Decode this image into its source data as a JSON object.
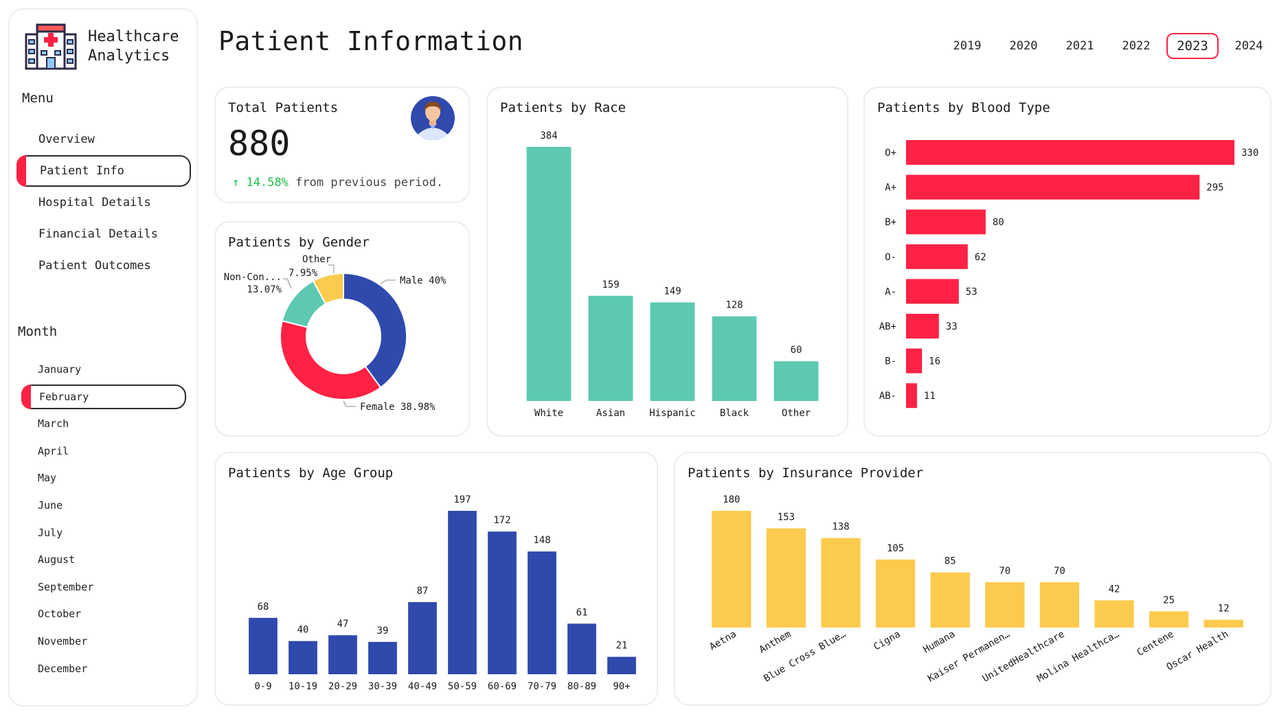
{
  "brand": {
    "title": "Healthcare\nAnalytics"
  },
  "menu": {
    "title": "Menu",
    "items": [
      {
        "label": "Overview",
        "active": false
      },
      {
        "label": "Patient Info",
        "active": true
      },
      {
        "label": "Hospital Details",
        "active": false
      },
      {
        "label": "Financial Details",
        "active": false
      },
      {
        "label": "Patient Outcomes",
        "active": false
      }
    ]
  },
  "month": {
    "title": "Month",
    "items": [
      {
        "label": "January",
        "active": false
      },
      {
        "label": "February",
        "active": true
      },
      {
        "label": "March",
        "active": false
      },
      {
        "label": "April",
        "active": false
      },
      {
        "label": "May",
        "active": false
      },
      {
        "label": "June",
        "active": false
      },
      {
        "label": "July",
        "active": false
      },
      {
        "label": "August",
        "active": false
      },
      {
        "label": "September",
        "active": false
      },
      {
        "label": "October",
        "active": false
      },
      {
        "label": "November",
        "active": false
      },
      {
        "label": "December",
        "active": false
      }
    ]
  },
  "header": {
    "title": "Patient Information",
    "years": [
      "2019",
      "2020",
      "2021",
      "2022",
      "2023",
      "2024"
    ],
    "selected_year": "2023"
  },
  "total": {
    "title": "Total Patients",
    "value": "880",
    "change": "14.58%",
    "change_arrow": "↑",
    "change_suffix": "from previous period."
  },
  "colors": {
    "accent": "#ff2244",
    "teal": "#5cc9b0",
    "red": "#ff2244",
    "blue": "#2f49ad",
    "yellow": "#fccb4e",
    "green": "#1cbf4a"
  },
  "chart_data": [
    {
      "id": "race",
      "type": "bar",
      "title": "Patients by Race",
      "categories": [
        "White",
        "Asian",
        "Hispanic",
        "Black",
        "Other"
      ],
      "values": [
        384,
        159,
        149,
        128,
        60
      ],
      "color": "#5cc9b0"
    },
    {
      "id": "blood",
      "type": "bar",
      "orientation": "horizontal",
      "title": "Patients by Blood Type",
      "categories": [
        "O+",
        "A+",
        "B+",
        "O-",
        "A-",
        "AB+",
        "B-",
        "AB-"
      ],
      "values": [
        330,
        295,
        80,
        62,
        53,
        33,
        16,
        11
      ],
      "color": "#ff2244"
    },
    {
      "id": "gender",
      "type": "pie",
      "donut": true,
      "title": "Patients by Gender",
      "slices": [
        {
          "name": "Male",
          "pct": 40,
          "label": "Male 40%",
          "color": "#2f49ad"
        },
        {
          "name": "Female",
          "pct": 38.98,
          "label": "Female 38.98%",
          "color": "#ff2244"
        },
        {
          "name": "Non-Con...",
          "pct": 13.07,
          "label": "Non-Con...",
          "label2": "13.07%",
          "color": "#5cc9b0"
        },
        {
          "name": "Other",
          "pct": 7.95,
          "label": "Other",
          "label2": "7.95%",
          "color": "#fccb4e"
        }
      ]
    },
    {
      "id": "age",
      "type": "bar",
      "title": "Patients by Age Group",
      "categories": [
        "0-9",
        "10-19",
        "20-29",
        "30-39",
        "40-49",
        "50-59",
        "60-69",
        "70-79",
        "80-89",
        "90+"
      ],
      "values": [
        68,
        40,
        47,
        39,
        87,
        197,
        172,
        148,
        61,
        21
      ],
      "color": "#2f49ad"
    },
    {
      "id": "insurance",
      "type": "bar",
      "title": "Patients by Insurance Provider",
      "categories": [
        "Aetna",
        "Anthem",
        "Blue Cross Blue…",
        "Cigna",
        "Humana",
        "Kaiser Permanen…",
        "UnitedHealthcare",
        "Molina Healthca…",
        "Centene",
        "Oscar Health"
      ],
      "values": [
        180,
        153,
        138,
        105,
        85,
        70,
        70,
        42,
        25,
        12
      ],
      "color": "#fccb4e"
    }
  ]
}
